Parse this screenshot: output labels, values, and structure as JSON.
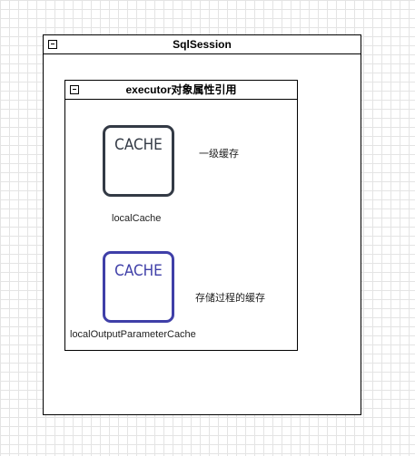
{
  "outer": {
    "title": "SqlSession"
  },
  "inner": {
    "title": "executor对象属性引用"
  },
  "caches": [
    {
      "icon_text": "CACHE",
      "caption": "localCache",
      "note": "一级缓存",
      "color": "#333a45"
    },
    {
      "icon_text": "CACHE",
      "caption": "localOutputParameterCache",
      "note": "存储过程的缓存",
      "color": "#3f3fa8"
    }
  ]
}
